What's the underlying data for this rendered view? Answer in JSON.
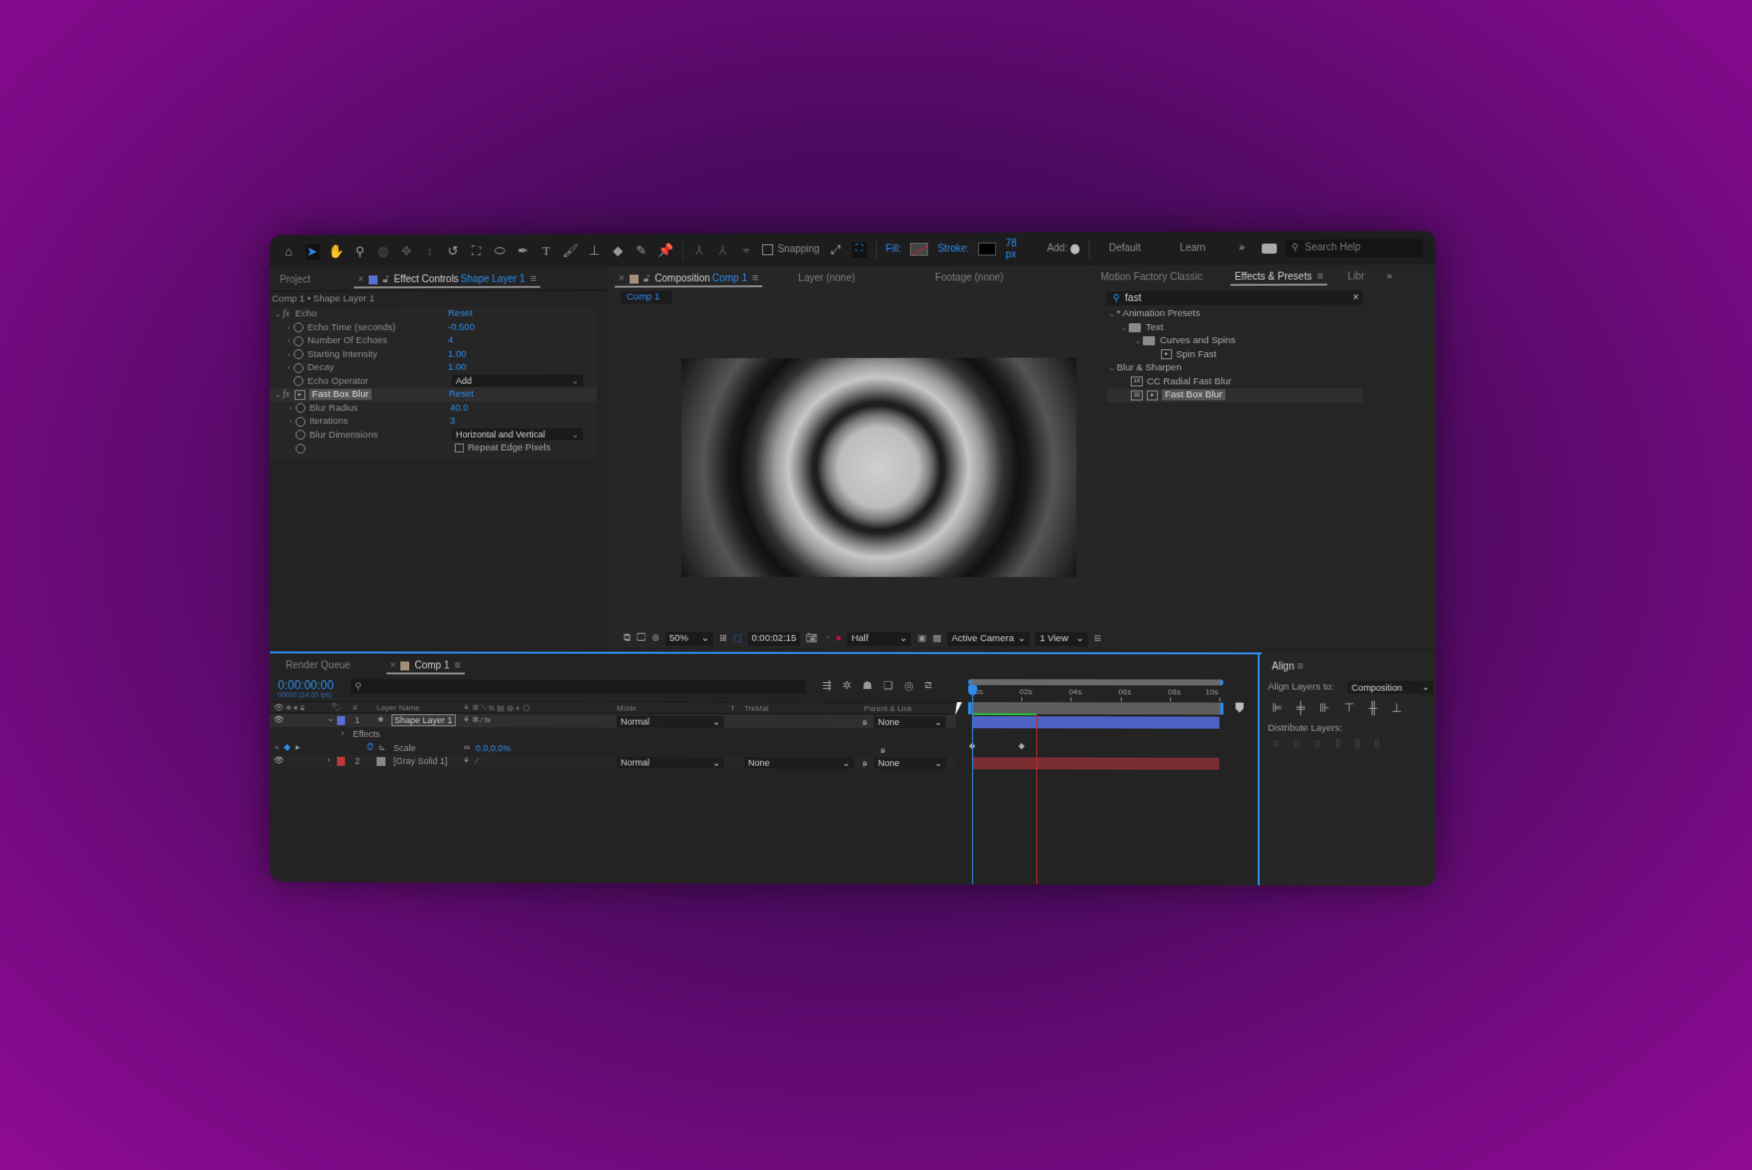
{
  "toolbar": {
    "snapping_label": "Snapping",
    "fill_label": "Fill:",
    "stroke_label": "Stroke:",
    "stroke_width": "78 px",
    "add_label": "Add:",
    "workspace_default": "Default",
    "workspace_learn": "Learn",
    "more": "»",
    "search_help_placeholder": "Search Help",
    "tools": [
      "home-icon",
      "selection-tool-icon",
      "hand-tool-icon",
      "zoom-tool-icon",
      "orbit-camera-icon",
      "pan-camera-icon",
      "dolly-camera-icon",
      "rotation-tool-icon",
      "pan-behind-icon",
      "ellipse-tool-icon",
      "pen-tool-icon",
      "type-tool-icon",
      "brush-tool-icon",
      "clone-stamp-icon",
      "eraser-icon",
      "roto-brush-icon",
      "puppet-pin-icon"
    ]
  },
  "left_panel": {
    "tabs": [
      {
        "label": "Project"
      },
      {
        "label": "Effect Controls",
        "target": "Shape Layer 1"
      }
    ],
    "breadcrumb": "Comp 1 • Shape Layer 1",
    "effects": [
      {
        "name": "Echo",
        "reset": "Reset",
        "properties": [
          {
            "label": "Echo Time (seconds)",
            "value": "-0.500"
          },
          {
            "label": "Number Of Echoes",
            "value": "4"
          },
          {
            "label": "Starting Intensity",
            "value": "1.00"
          },
          {
            "label": "Decay",
            "value": "1.00"
          },
          {
            "label": "Echo Operator",
            "value": "Add"
          }
        ]
      },
      {
        "name": "Fast Box Blur",
        "reset": "Reset",
        "properties": [
          {
            "label": "Blur Radius",
            "value": "40.0"
          },
          {
            "label": "Iterations",
            "value": "3"
          },
          {
            "label": "Blur Dimensions",
            "value": "Horizontal and Vertical"
          },
          {
            "label": "",
            "value": "Repeat Edge Pixels",
            "checked": false
          }
        ]
      }
    ]
  },
  "composition_panel": {
    "tabs": [
      {
        "label": "Composition",
        "target": "Comp 1"
      },
      {
        "label": "Layer (none)"
      },
      {
        "label": "Footage (none)"
      }
    ],
    "sub_tab": "Comp 1",
    "status": {
      "zoom": "50%",
      "timecode": "0:00:02:15",
      "resolution": "Half",
      "camera": "Active Camera",
      "views": "1 View"
    }
  },
  "right_panel": {
    "tabs": [
      {
        "label": "Motion Factory Classic"
      },
      {
        "label": "Effects & Presets"
      },
      {
        "label": "Libr"
      }
    ],
    "search_value": "fast",
    "tree": [
      {
        "label": "* Animation Presets",
        "level": 0,
        "type": "group"
      },
      {
        "label": "Text",
        "level": 1,
        "type": "folder"
      },
      {
        "label": "Curves and Spins",
        "level": 2,
        "type": "folder"
      },
      {
        "label": "Spin Fast",
        "level": 3,
        "type": "preset"
      },
      {
        "label": "Blur & Sharpen",
        "level": 0,
        "type": "group"
      },
      {
        "label": "CC Radial Fast Blur",
        "level": 1,
        "type": "effect",
        "badge": "16"
      },
      {
        "label": "Fast Box Blur",
        "level": 1,
        "type": "effect",
        "badge": "32",
        "selected": true
      }
    ]
  },
  "timeline": {
    "tabs": [
      {
        "label": "Render Queue"
      },
      {
        "label": "Comp 1"
      }
    ],
    "timecode": "0:00:00:00",
    "frame_info": "00000 (24.00 fps)",
    "columns": {
      "hash": "#",
      "layer_name": "Layer Name",
      "mode": "Mode",
      "t": "T",
      "trkmat": "TrkMat",
      "parent": "Parent & Link"
    },
    "ruler": [
      "00s",
      "02s",
      "04s",
      "06s",
      "08s",
      "10s"
    ],
    "current_time_seconds": 0,
    "work_area_end_seconds": 2.6,
    "layers": [
      {
        "index": "1",
        "name": "Shape Layer 1",
        "color": "#5a6fd6",
        "mode": "Normal",
        "trkmat": "",
        "parent": "None",
        "expanded": true,
        "selected": true
      },
      {
        "index": "2",
        "name": "[Gray Solid 1]",
        "color": "#c0393b",
        "mode": "Normal",
        "trkmat": "None",
        "parent": "None",
        "expanded": false
      }
    ],
    "sub_rows": {
      "effects_label": "Effects",
      "scale_label": "Scale",
      "scale_value": "0.0,0.0%"
    }
  },
  "align_panel": {
    "title": "Align",
    "align_to_label": "Align Layers to:",
    "align_to_value": "Composition",
    "distribute_label": "Distribute Layers:"
  },
  "colors": {
    "accent": "#2d8ceb",
    "layer1": "#5a6fd6",
    "layer2": "#c0393b",
    "work_area": "#2cb83a",
    "cti": "#c0282d"
  }
}
